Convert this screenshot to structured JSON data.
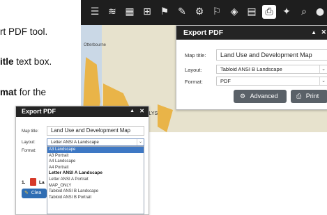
{
  "doc": {
    "line1": "rt PDF tool.",
    "line2_bold": "itle",
    "line2_rest": " text box.",
    "line3_bold": "mat",
    "line3_rest": " for the",
    "step_number": "1.",
    "step_text": "La",
    "clear_label": "Clea"
  },
  "map": {
    "place_label": "Otterbourne",
    "fragment_label": "OLYS",
    "colors": {
      "land": "#e9b448",
      "water": "#cad8e6",
      "background": "#e7e2cd"
    }
  },
  "toolbar": {
    "icons": [
      "list-icon",
      "layers-icon",
      "grid-icon",
      "basemap-icon",
      "bookmark-icon",
      "draw-icon",
      "share-icon",
      "measure-icon",
      "legend-icon",
      "table-icon",
      "print-icon",
      "location-icon",
      "search-icon",
      "info-icon"
    ],
    "active_icon": "print-icon"
  },
  "export_pdf": {
    "title": "Export PDF",
    "collapse_glyph": "▲",
    "close_glyph": "✕",
    "map_title_label": "Map title:",
    "map_title_value": "Land Use and Development Map",
    "layout_label": "Layout:",
    "layout_value": "Tabloid ANSI B Landscape",
    "format_label": "Format:",
    "format_value": "PDF",
    "advanced_label": "Advanced",
    "print_label": "Print"
  },
  "export_pdf_small": {
    "title": "Export PDF",
    "collapse_glyph": "▲",
    "close_glyph": "✕",
    "map_title_label": "Map title:",
    "map_title_value": "Land Use and Development Map",
    "layout_label": "Layout:",
    "layout_value": "Letter ANSI A Landscape",
    "format_label": "Format:",
    "layout_options": [
      "A3 Landscape",
      "A3 Portrait",
      "A4 Landscape",
      "A4 Portrait",
      "Letter ANSI A Landscape",
      "Letter ANSI A Portrait",
      "MAP_ONLY",
      "Tabloid ANSI B Landscape",
      "Tabloid ANSI B Portrait"
    ],
    "highlighted_option": "A3 Landscape",
    "bold_option": "Letter ANSI A Landscape"
  }
}
